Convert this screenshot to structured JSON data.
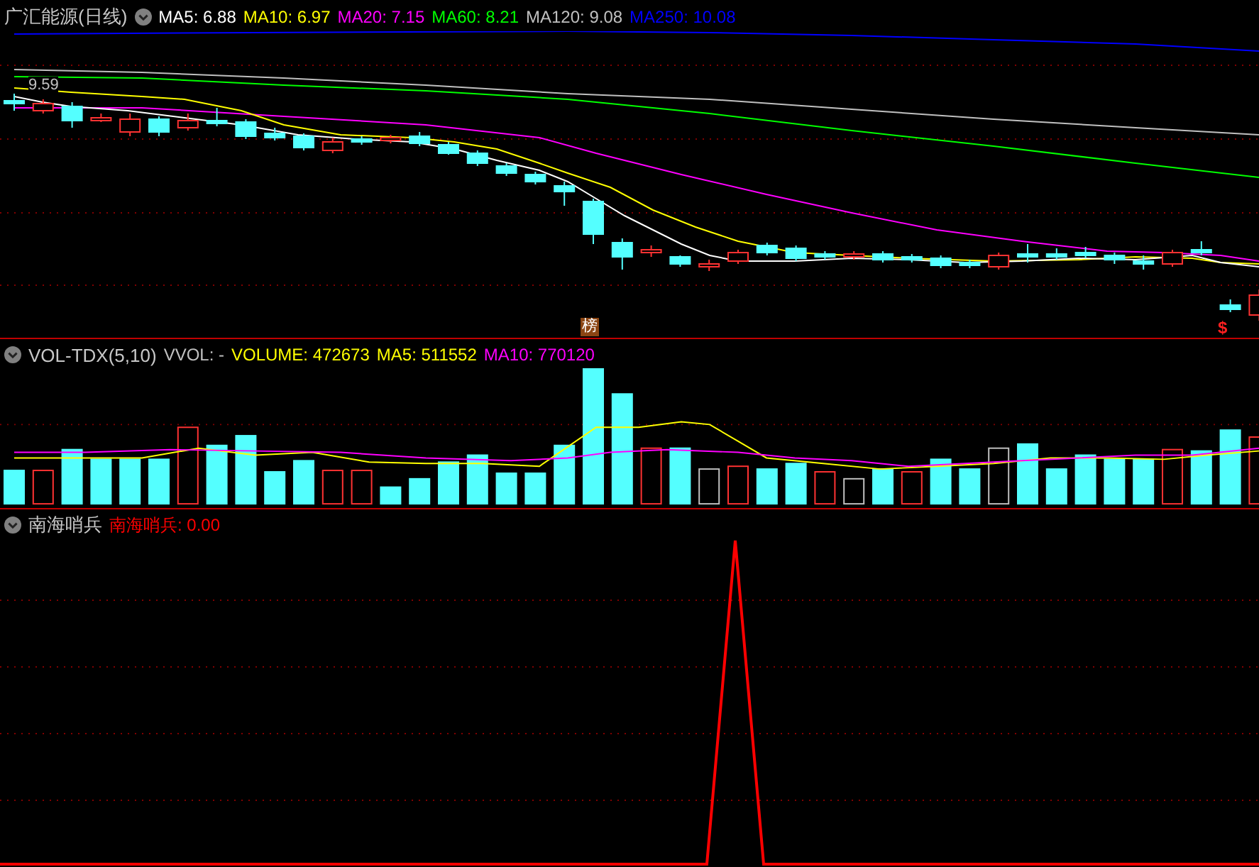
{
  "main_panel": {
    "title": "广汇能源(日线)",
    "indicators": [
      {
        "label": "MA5: 6.88",
        "color": "#ffffff"
      },
      {
        "label": "MA10: 6.97",
        "color": "#ffff00"
      },
      {
        "label": "MA20: 7.15",
        "color": "#ff00ff"
      },
      {
        "label": "MA60: 8.21",
        "color": "#00ff00"
      },
      {
        "label": "MA120: 9.08",
        "color": "#c0c0c0"
      },
      {
        "label": "MA250: 10.08",
        "color": "#0000ff"
      }
    ],
    "price_label": "9.59",
    "markers": [
      {
        "kind": "badge",
        "text": "榜"
      },
      {
        "kind": "signal",
        "text": "$"
      }
    ]
  },
  "volume_panel": {
    "title": "VOL-TDX(5,10)",
    "items": [
      {
        "label": "VVOL: -",
        "color": "#c0c0c0"
      },
      {
        "label": "VOLUME: 472673",
        "color": "#ffff00"
      },
      {
        "label": "MA5: 511552",
        "color": "#ffff00"
      },
      {
        "label": "MA10: 770120",
        "color": "#ff00ff"
      }
    ]
  },
  "indicator_panel": {
    "title": "南海哨兵",
    "items": [
      {
        "label": "南海哨兵: 0.00",
        "color": "#ff0000"
      }
    ]
  }
}
